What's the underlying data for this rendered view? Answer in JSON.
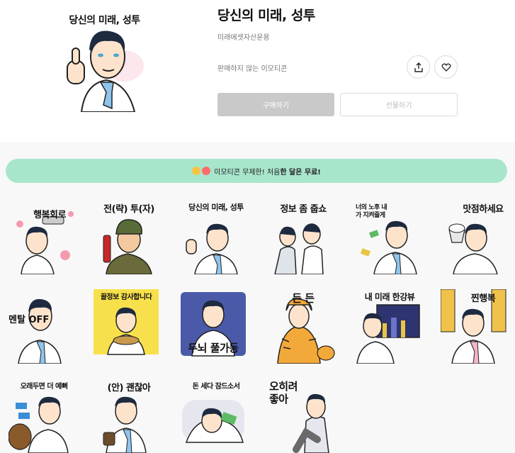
{
  "product": {
    "title": "당신의 미래, 성투",
    "company": "미래에셋자산운용",
    "status": "판매하지 않는 이모티콘",
    "hero_caption": "당신의 미래, 성투",
    "buy_label": "구매하기",
    "gift_label": "선물하기",
    "share_icon": "share-icon",
    "like_icon": "heart-icon"
  },
  "banner": {
    "text_prefix": "이모티콘 무제한! 처음 ",
    "text_bold": "한 달은 무료!",
    "accent": "#a8e6cc"
  },
  "stickers": [
    {
      "caption": "행복회로"
    },
    {
      "caption": "전(략)  투(자)"
    },
    {
      "caption": "당신의 미래, 성투"
    },
    {
      "caption": "정보 좀 줍쇼"
    },
    {
      "caption": "너의 노후 내가 지켜줄게"
    },
    {
      "caption": "맛점하세요"
    },
    {
      "caption": "멘탈 OFF"
    },
    {
      "caption": "꿀정보 감사합니다"
    },
    {
      "caption": "두뇌 풀가동"
    },
    {
      "caption": "든    든"
    },
    {
      "caption": "내 미래 한강뷰"
    },
    {
      "caption": "찐행복"
    },
    {
      "caption": "오래두면 더 예뻐"
    },
    {
      "caption": "(안) 괜찮아"
    },
    {
      "caption": "돈 세다 잠드소서"
    },
    {
      "caption": "오히려 좋아"
    }
  ]
}
